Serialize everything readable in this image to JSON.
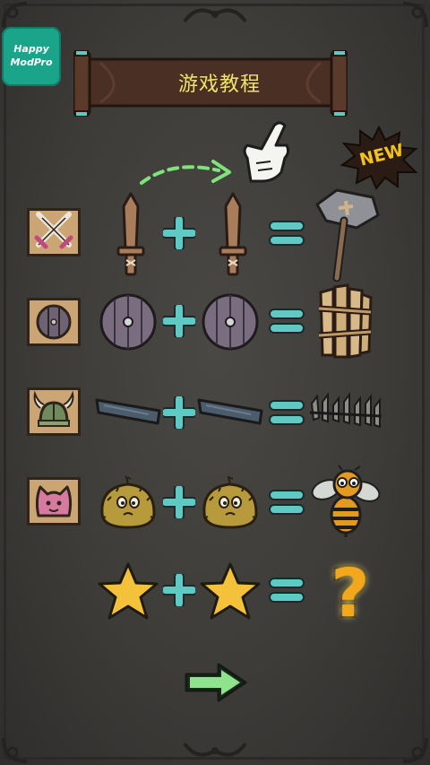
{
  "app": {
    "logo_line1": "Happy",
    "logo_line2": "ModPro"
  },
  "tutorial": {
    "title": "游戏教程",
    "new_badge": "NEW",
    "result_unknown": "?"
  },
  "colors": {
    "background": "#3e3c39",
    "operator": "#5fc9c4",
    "title_text": "#f1e36a",
    "new_badge_text": "#f4c21a",
    "question_mark": "#f2a71c",
    "arrow": "#8ee38c",
    "dashed_arrow": "#7fe37a"
  },
  "rows": [
    {
      "category_icon": "crossed-swords-icon",
      "input": "wooden-sword-icon",
      "result": "stone-hammer-icon"
    },
    {
      "category_icon": "shield-icon",
      "input": "round-shield-icon",
      "result": "wooden-barricade-icon"
    },
    {
      "category_icon": "viking-helmet-icon",
      "input": "wooden-plank-icon",
      "result": "spike-fence-icon"
    },
    {
      "category_icon": "cat-face-icon",
      "input": "fuzzy-creature-icon",
      "result": "bee-icon"
    },
    {
      "category_icon": "",
      "input": "star-icon",
      "result": "question-mark"
    }
  ],
  "hints": {
    "pointer_icon": "pointing-hand-icon",
    "drag_arrow_icon": "dashed-arrow-icon"
  },
  "navigation": {
    "next_icon": "next-arrow-icon"
  }
}
